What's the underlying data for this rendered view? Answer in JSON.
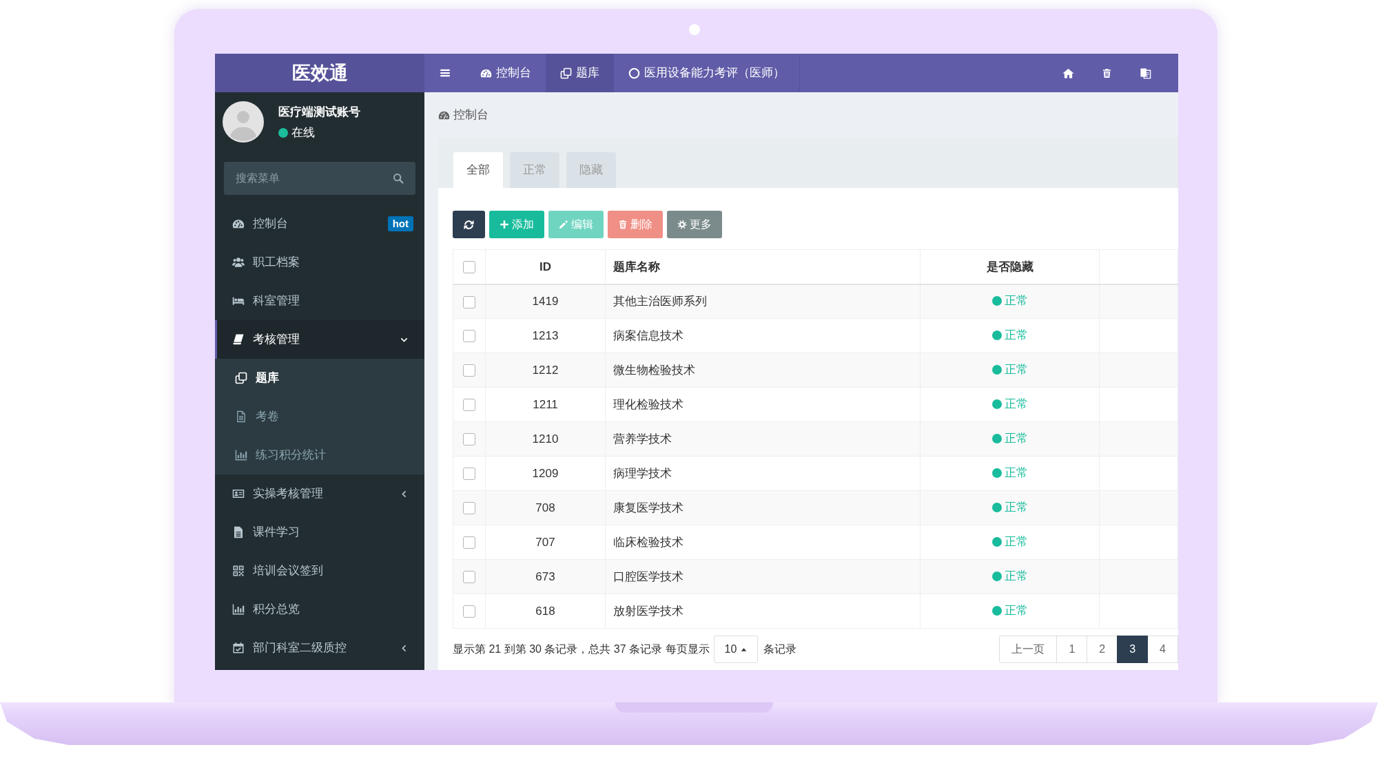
{
  "app": {
    "logo": "医效通"
  },
  "top_nav": {
    "tabs": [
      {
        "label": "控制台",
        "selected": false
      },
      {
        "label": "题库",
        "selected": true
      },
      {
        "label": "医用设备能力考评（医师）",
        "selected": false
      }
    ]
  },
  "user": {
    "name": "医疗端测试账号",
    "status": "在线"
  },
  "sidebar": {
    "search": {
      "placeholder": "搜索菜单"
    },
    "items": [
      {
        "kind": "link",
        "label": "控制台",
        "badge": "hot",
        "selected": false
      },
      {
        "kind": "link",
        "label": "职工档案",
        "selected": false
      },
      {
        "kind": "link",
        "label": "科室管理",
        "selected": false
      },
      {
        "kind": "group",
        "label": "考核管理",
        "selected": true,
        "expanded": true,
        "children": [
          {
            "label": "题库",
            "selected": true
          },
          {
            "label": "考卷",
            "selected": false
          },
          {
            "label": "练习积分统计",
            "selected": false
          }
        ]
      },
      {
        "kind": "group",
        "label": "实操考核管理",
        "selected": false,
        "expanded": false
      },
      {
        "kind": "link",
        "label": "课件学习",
        "selected": false
      },
      {
        "kind": "link",
        "label": "培训会议签到",
        "selected": false
      },
      {
        "kind": "link",
        "label": "积分总览",
        "selected": false
      },
      {
        "kind": "group",
        "label": "部门科室二级质控",
        "selected": false,
        "expanded": false
      }
    ]
  },
  "breadcrumb": {
    "label": "控制台"
  },
  "panel": {
    "tabs": [
      {
        "label": "全部",
        "selected": true
      },
      {
        "label": "正常",
        "selected": false
      },
      {
        "label": "隐藏",
        "selected": false
      }
    ],
    "toolbar": [
      {
        "kind": "refresh",
        "disabled": false
      },
      {
        "kind": "add",
        "label": "添加",
        "disabled": false
      },
      {
        "kind": "edit",
        "label": "编辑",
        "disabled": true
      },
      {
        "kind": "delete",
        "label": "删除",
        "disabled": true
      },
      {
        "kind": "more",
        "label": "更多",
        "disabled": false
      }
    ],
    "table": {
      "select_all": {
        "checked": false
      },
      "columns": [
        "ID",
        "题库名称",
        "是否隐藏"
      ],
      "rows": [
        {
          "checked": false,
          "id": "1419",
          "name": "其他主治医师系列",
          "status": "正常"
        },
        {
          "checked": false,
          "id": "1213",
          "name": "病案信息技术",
          "status": "正常"
        },
        {
          "checked": false,
          "id": "1212",
          "name": "微生物检验技术",
          "status": "正常"
        },
        {
          "checked": false,
          "id": "1211",
          "name": "理化检验技术",
          "status": "正常"
        },
        {
          "checked": false,
          "id": "1210",
          "name": "营养学技术",
          "status": "正常"
        },
        {
          "checked": false,
          "id": "1209",
          "name": "病理学技术",
          "status": "正常"
        },
        {
          "checked": false,
          "id": "708",
          "name": "康复医学技术",
          "status": "正常"
        },
        {
          "checked": false,
          "id": "707",
          "name": "临床检验技术",
          "status": "正常"
        },
        {
          "checked": false,
          "id": "673",
          "name": "口腔医学技术",
          "status": "正常"
        },
        {
          "checked": false,
          "id": "618",
          "name": "放射医学技术",
          "status": "正常"
        }
      ]
    },
    "footer": {
      "summary": "显示第 21 到第 30 条记录，总共 37 条记录 每页显示",
      "page_size": "10",
      "suffix": "条记录"
    },
    "pagination": [
      {
        "label": "上一页",
        "selected": false
      },
      {
        "label": "1",
        "selected": false
      },
      {
        "label": "2",
        "selected": false
      },
      {
        "label": "3",
        "selected": true
      },
      {
        "label": "4",
        "selected": false
      }
    ]
  }
}
